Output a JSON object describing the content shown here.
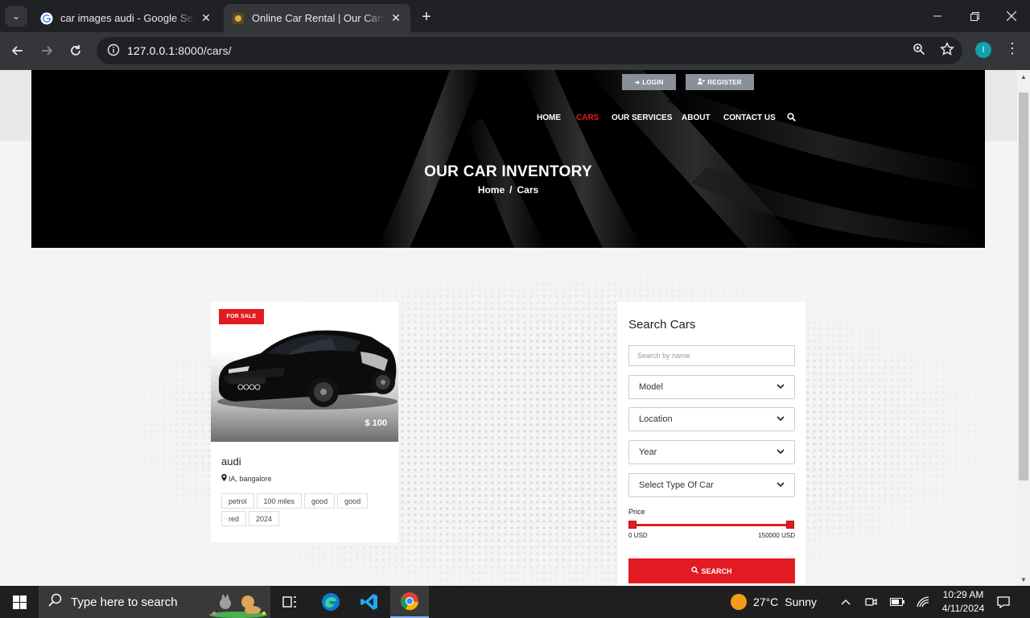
{
  "browser": {
    "tabs": [
      {
        "title": "car images audi - Google Search",
        "active": false
      },
      {
        "title": "Online Car Rental | Our Cars Inventory",
        "active": true
      }
    ],
    "url_host": "127.0.0.1",
    "url_rest": ":8000/cars/",
    "profile_initial": "I"
  },
  "header": {
    "login_label": "LOGIN",
    "register_label": "REGISTER",
    "nav": {
      "home": "HOME",
      "cars": "CARS",
      "services": "OUR SERVICES",
      "about": "ABOUT",
      "contact": "CONTACT US"
    },
    "active_nav": "CARS",
    "title": "OUR CAR INVENTORY",
    "breadcrumb": {
      "home": "Home",
      "sep": "/",
      "current": "Cars"
    }
  },
  "car": {
    "badge": "FOR SALE",
    "price": "$ 100",
    "name": "audi",
    "location": "IA, bangalore",
    "tags": [
      "petrol",
      "100 miles",
      "good",
      "good",
      "red",
      "2024"
    ]
  },
  "search": {
    "title": "Search Cars",
    "placeholder": "Search by name",
    "selects": {
      "model": "Model",
      "location": "Location",
      "year": "Year",
      "type": "Select Type Of Car"
    },
    "price_label": "Price",
    "min": "0 USD",
    "max": "150000 USD",
    "button": "SEARCH"
  },
  "taskbar": {
    "search_placeholder": "Type here to search",
    "weather": "27°C",
    "weather_text": "Sunny",
    "time": "10:29 AM",
    "date": "4/11/2024"
  },
  "colors": {
    "accent": "#e21b23",
    "hero_bg": "#000000",
    "chrome_dark": "#202124",
    "chrome_mid": "#35363a"
  }
}
